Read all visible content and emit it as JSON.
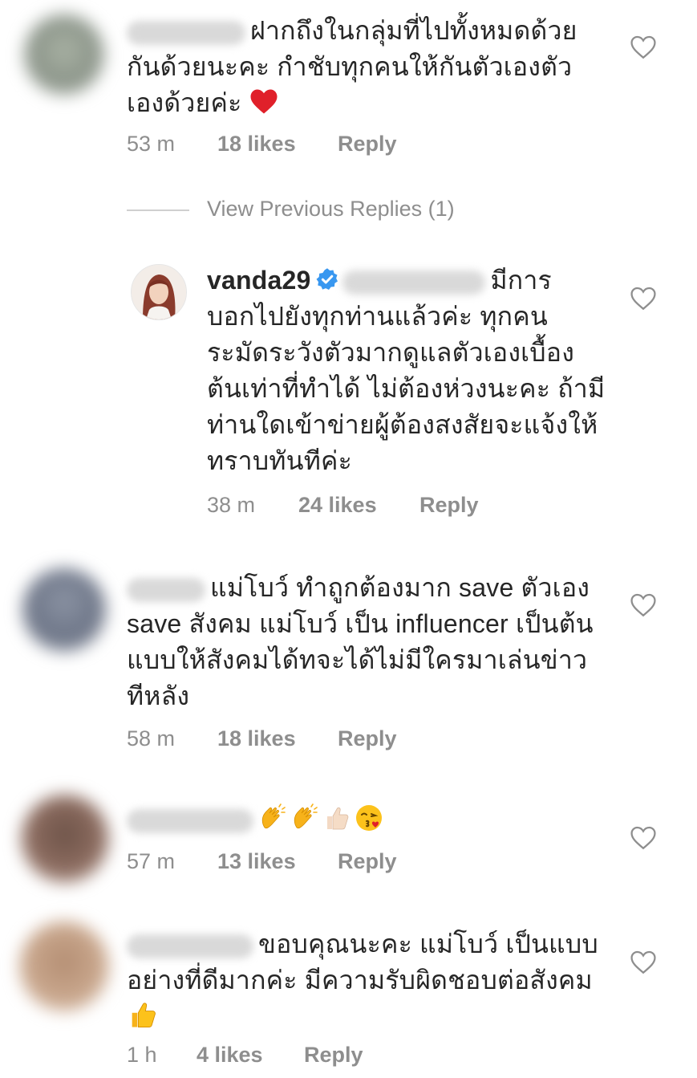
{
  "colors": {
    "text": "#262626",
    "meta": "#8e8e8e",
    "verified": "#3897f0",
    "heart_red": "#e0202a"
  },
  "comments": [
    {
      "text": "ฝากถึงในกลุ่มที่ไปทั้งหมดด้วยกันด้วยนะคะ กำชับทุกคนให้กันตัวเองตัวเองด้วยค่ะ",
      "line1": "ฝากถึงในกลุ่มที่ไปทั้งหมดด้วย",
      "line2": "กันด้วยนะคะ กำชับทุกคนให้กันตัวเองตัว",
      "line3": "เองด้วยค่ะ",
      "time": "53 m",
      "likes": "18 likes",
      "reply": "Reply",
      "emoji_icon": "red-heart-emoji"
    },
    {
      "username": "vanda29",
      "verified_icon": "verified-badge-icon",
      "line1": "มีการ",
      "line2": "บอกไปยังทุกท่านแล้วค่ะ ทุกคน",
      "line3": "ระมัดระวังตัวมากดูแลตัวเองเบื้อง",
      "line4": "ต้นเท่าที่ทำได้ ไม่ต้องห่วงนะคะ ถ้ามี",
      "line5": "ท่านใดเข้าข่ายผู้ต้องสงสัยจะแจ้งให้",
      "line6": "ทราบทันทีค่ะ",
      "time": "38 m",
      "likes": "24 likes",
      "reply": "Reply"
    },
    {
      "line1": "แม่โบว์ ทำถูกต้องมาก save ตัวเอง",
      "line2": "save สังคม แม่โบว์ เป็น influencer เป็นต้น",
      "line3": "แบบให้สังคมได้ทจะได้ไม่มีใครมาเล่นข่าว",
      "line4": "ทีหลัง",
      "time": "58 m",
      "likes": "18 likes",
      "reply": "Reply"
    },
    {
      "emojis": [
        "clapping-hands-emoji",
        "clapping-hands-emoji",
        "thumbs-up-emoji",
        "kissing-face-emoji"
      ],
      "time": "57 m",
      "likes": "13 likes",
      "reply": "Reply"
    },
    {
      "line1": "ขอบคุณนะคะ แม่โบว์ เป็นแบบ",
      "line2": "อย่างที่ดีมากค่ะ มีความรับผิดชอบต่อสังคม",
      "emoji_icon": "thumbs-up-emoji",
      "time": "1 h",
      "likes": "4 likes",
      "reply": "Reply"
    }
  ],
  "view_previous": "View Previous Replies (1)",
  "heart_icon": "heart-outline-icon"
}
